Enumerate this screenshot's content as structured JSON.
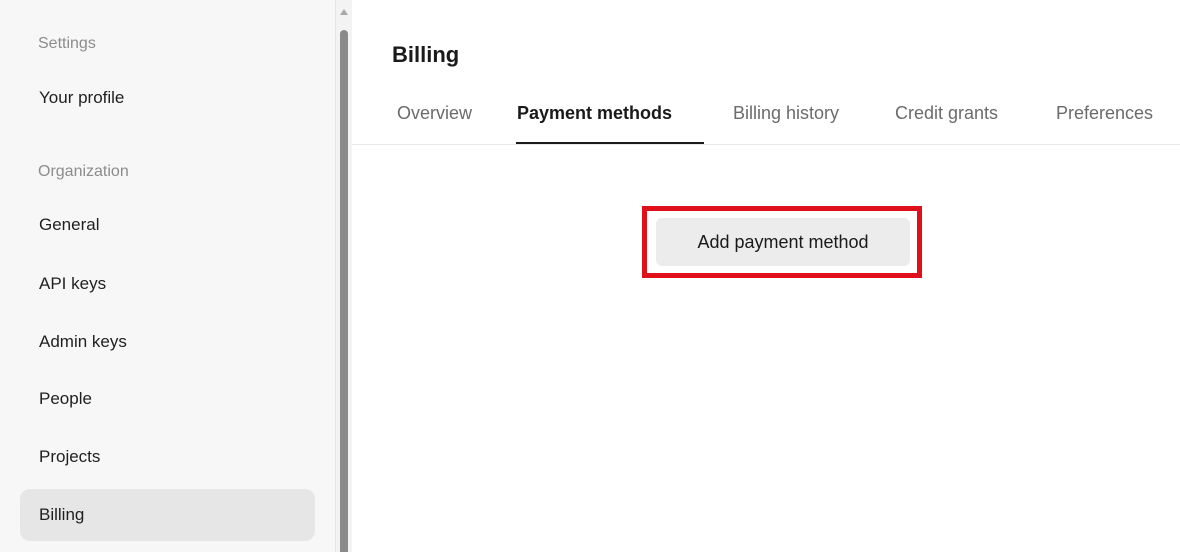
{
  "sidebar": {
    "section_settings": "Settings",
    "your_profile": "Your profile",
    "section_organization": "Organization",
    "items": [
      {
        "label": "General"
      },
      {
        "label": "API keys"
      },
      {
        "label": "Admin keys"
      },
      {
        "label": "People"
      },
      {
        "label": "Projects"
      },
      {
        "label": "Billing",
        "active": true
      }
    ]
  },
  "main": {
    "title": "Billing",
    "tabs": [
      {
        "label": "Overview"
      },
      {
        "label": "Payment methods",
        "active": true
      },
      {
        "label": "Billing history"
      },
      {
        "label": "Credit grants"
      },
      {
        "label": "Preferences"
      }
    ],
    "add_payment_label": "Add payment method"
  },
  "colors": {
    "highlight": "#e0101a",
    "active_nav_bg": "#e6e6e7",
    "button_bg": "#ececed"
  }
}
